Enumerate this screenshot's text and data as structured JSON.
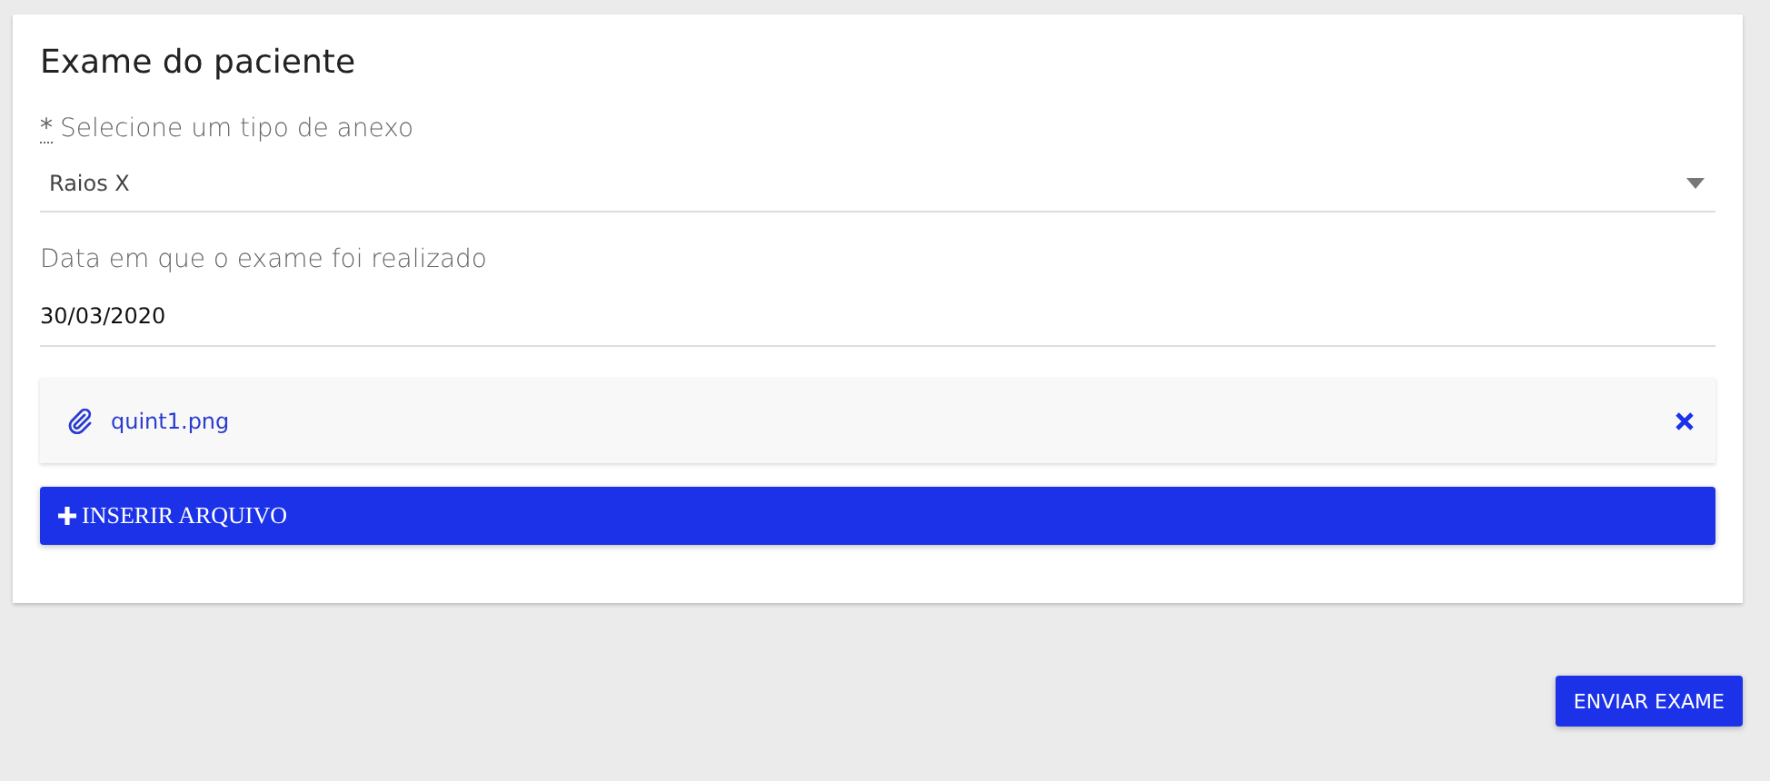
{
  "card": {
    "title": "Exame do paciente",
    "type_field": {
      "required_mark": "*",
      "label": "Selecione um tipo de anexo",
      "value": "Raios X"
    },
    "date_field": {
      "label": "Data em que o exame foi realizado",
      "value": "30/03/2020"
    },
    "attachments": [
      {
        "name": "quint1.png"
      }
    ],
    "add_button": "INSERIR ARQUIVO"
  },
  "submit_button": "ENVIAR EXAME"
}
